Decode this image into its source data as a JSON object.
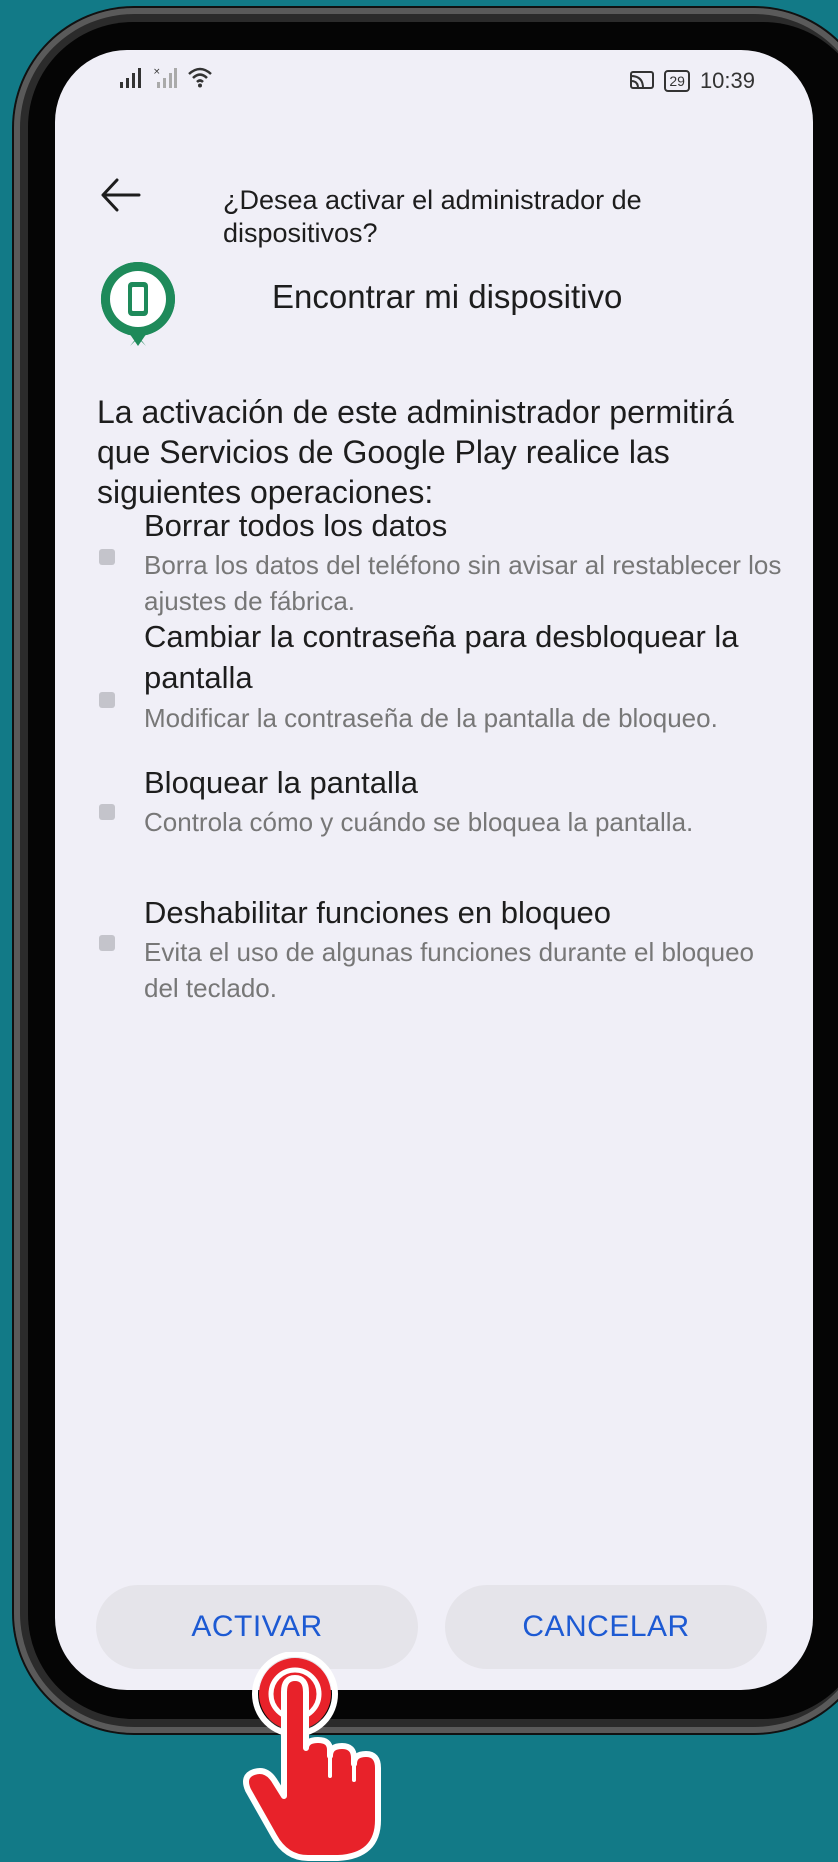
{
  "status_bar": {
    "time": "10:39",
    "battery": "29"
  },
  "header": {
    "title": "¿Desea activar el administrador de dispositivos?"
  },
  "app": {
    "name": "Encontrar mi dispositivo"
  },
  "description": "La activación de este administrador permitirá que Servicios de Google Play realice las siguientes operaciones:",
  "permissions": [
    {
      "title": "Borrar todos los datos",
      "desc": "Borra los datos del teléfono sin avisar al restablecer los ajustes de fábrica."
    },
    {
      "title": "Cambiar la contraseña para desbloquear la pantalla",
      "desc": "Modificar la contraseña de la pantalla de bloqueo."
    },
    {
      "title": "Bloquear la pantalla",
      "desc": "Controla cómo y cuándo se bloquea la pantalla."
    },
    {
      "title": "Deshabilitar funciones en bloqueo",
      "desc": "Evita el uso de algunas funciones durante el bloqueo del teclado."
    }
  ],
  "buttons": {
    "activate": "ACTIVAR",
    "cancel": "CANCELAR"
  },
  "colors": {
    "background": "#127a87",
    "screen": "#f0eff7",
    "accent": "#1d5ad3",
    "app_icon": "#1e8a5a",
    "hand": "#e8222a"
  }
}
